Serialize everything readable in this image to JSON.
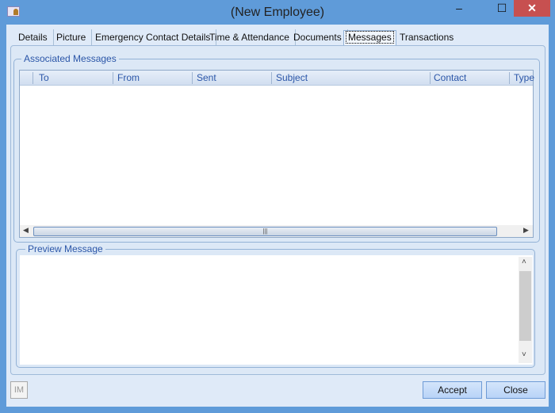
{
  "window": {
    "title": "(New Employee)",
    "minimize": "‒",
    "maximize": "☐",
    "close": "✕"
  },
  "tabs": [
    {
      "label": "Details"
    },
    {
      "label": "Picture"
    },
    {
      "label": "Emergency Contact Details"
    },
    {
      "label": "Time & Attendance"
    },
    {
      "label": "Documents"
    },
    {
      "label": "Messages",
      "active": true
    },
    {
      "label": "Transactions"
    }
  ],
  "associated": {
    "label": "Associated Messages",
    "columns": [
      "To",
      "From",
      "Sent",
      "Subject",
      "Contact",
      "Type"
    ],
    "rows": []
  },
  "preview": {
    "label": "Preview Message",
    "text": ""
  },
  "footer": {
    "im": "IM",
    "accept": "Accept",
    "close": "Close"
  }
}
